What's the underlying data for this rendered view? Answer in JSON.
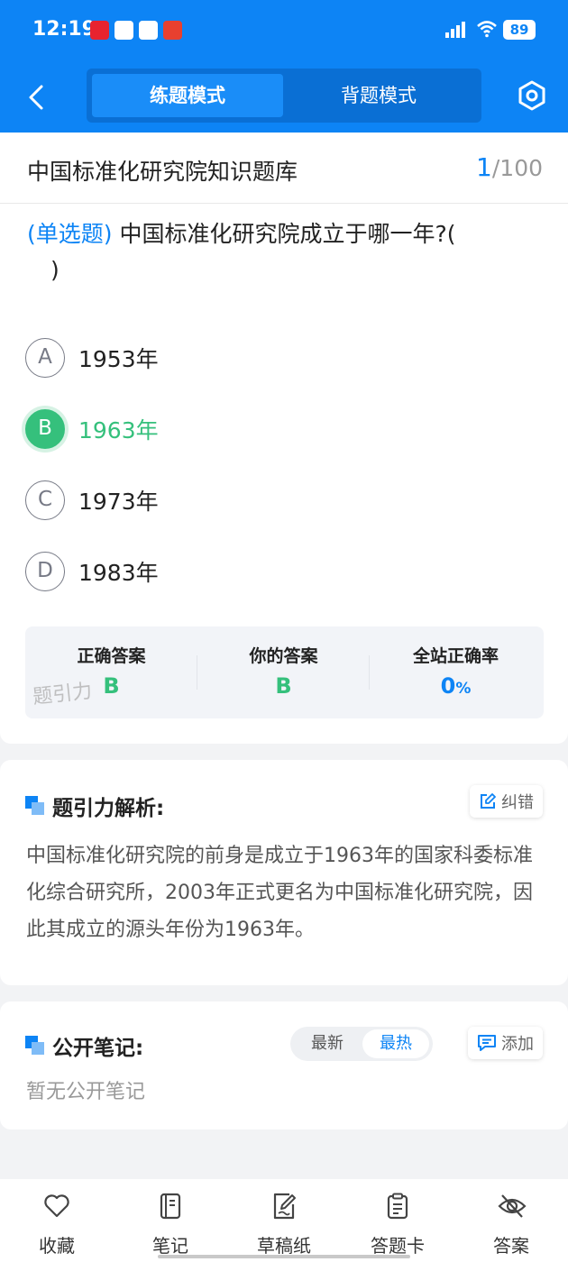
{
  "status_bar": {
    "time": "12:19",
    "network": "4G",
    "battery": "89"
  },
  "header": {
    "modes": [
      "练题模式",
      "背题模式"
    ],
    "active_mode": "练题模式"
  },
  "bank": {
    "title": "中国标准化研究院知识题库",
    "current": "1",
    "total": "/100"
  },
  "question": {
    "type": "(单选题)",
    "text": " 中国标准化研究院成立于哪一年?(",
    "close_paren": ")",
    "options": [
      {
        "letter": "A",
        "text": "1953年"
      },
      {
        "letter": "B",
        "text": "1963年"
      },
      {
        "letter": "C",
        "text": "1973年"
      },
      {
        "letter": "D",
        "text": "1983年"
      }
    ],
    "selected": "B"
  },
  "stats": {
    "correct_label": "正确答案",
    "correct_value": "B",
    "yours_label": "你的答案",
    "yours_value": "B",
    "rate_label": "全站正确率",
    "rate_value": "0",
    "rate_unit": "%",
    "watermark": "题引力"
  },
  "analysis": {
    "title": "题引力解析:",
    "report_label": "纠错",
    "text": "中国标准化研究院的前身是成立于1963年的国家科委标准化综合研究所，2003年正式更名为中国标准化研究院，因此其成立的源头年份为1963年。"
  },
  "notes": {
    "title": "公开笔记:",
    "sort_options": [
      "最新",
      "最热"
    ],
    "active_sort": "最热",
    "add_label": "添加",
    "empty_text": "暂无公开笔记"
  },
  "bottom_nav": [
    "收藏",
    "笔记",
    "草稿纸",
    "答题卡",
    "答案"
  ],
  "colors": {
    "primary": "#0d84f5",
    "correct": "#35c07c"
  }
}
